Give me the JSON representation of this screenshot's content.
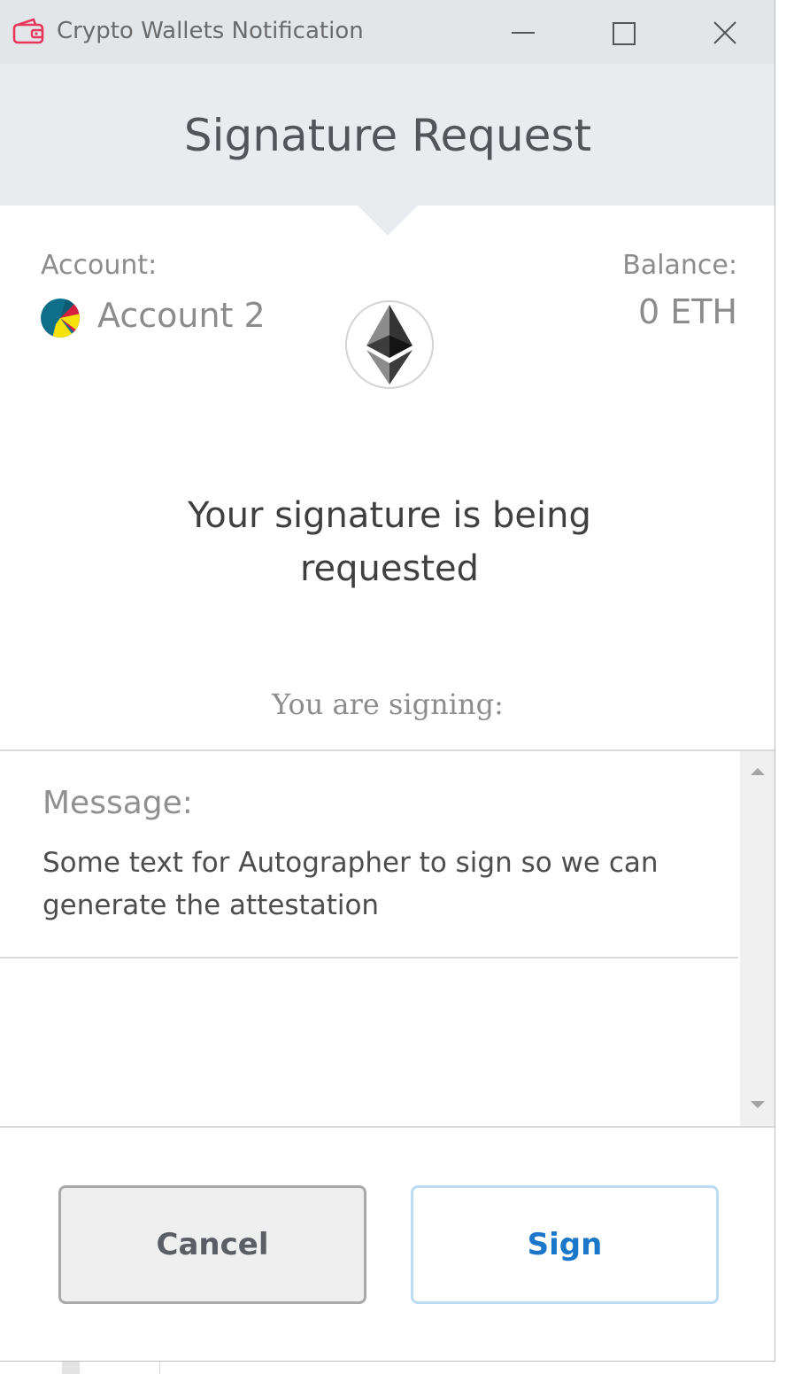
{
  "window": {
    "title": "Crypto Wallets Notification"
  },
  "header": {
    "title": "Signature Request"
  },
  "account": {
    "label": "Account:",
    "name": "Account 2"
  },
  "balance": {
    "label": "Balance:",
    "value": "0 ETH"
  },
  "request": {
    "heading": "Your signature is being requested",
    "signing_label": "You are signing:"
  },
  "message": {
    "label": "Message:",
    "text": "Some text for Autographer to sign so we can generate the attestation"
  },
  "actions": {
    "cancel_label": "Cancel",
    "sign_label": "Sign"
  },
  "colors": {
    "accent": "#1a77c9",
    "sign_border": "#bcdcf4",
    "header_bg": "#e9ecef",
    "titlebar_bg": "#e3e6e9",
    "app_icon": "#e8365d"
  },
  "icons": {
    "app": "wallet-icon",
    "minimize": "minimize-icon",
    "maximize": "maximize-icon",
    "close": "close-icon",
    "network": "ethereum-icon",
    "avatar": "account-avatar-icon"
  }
}
